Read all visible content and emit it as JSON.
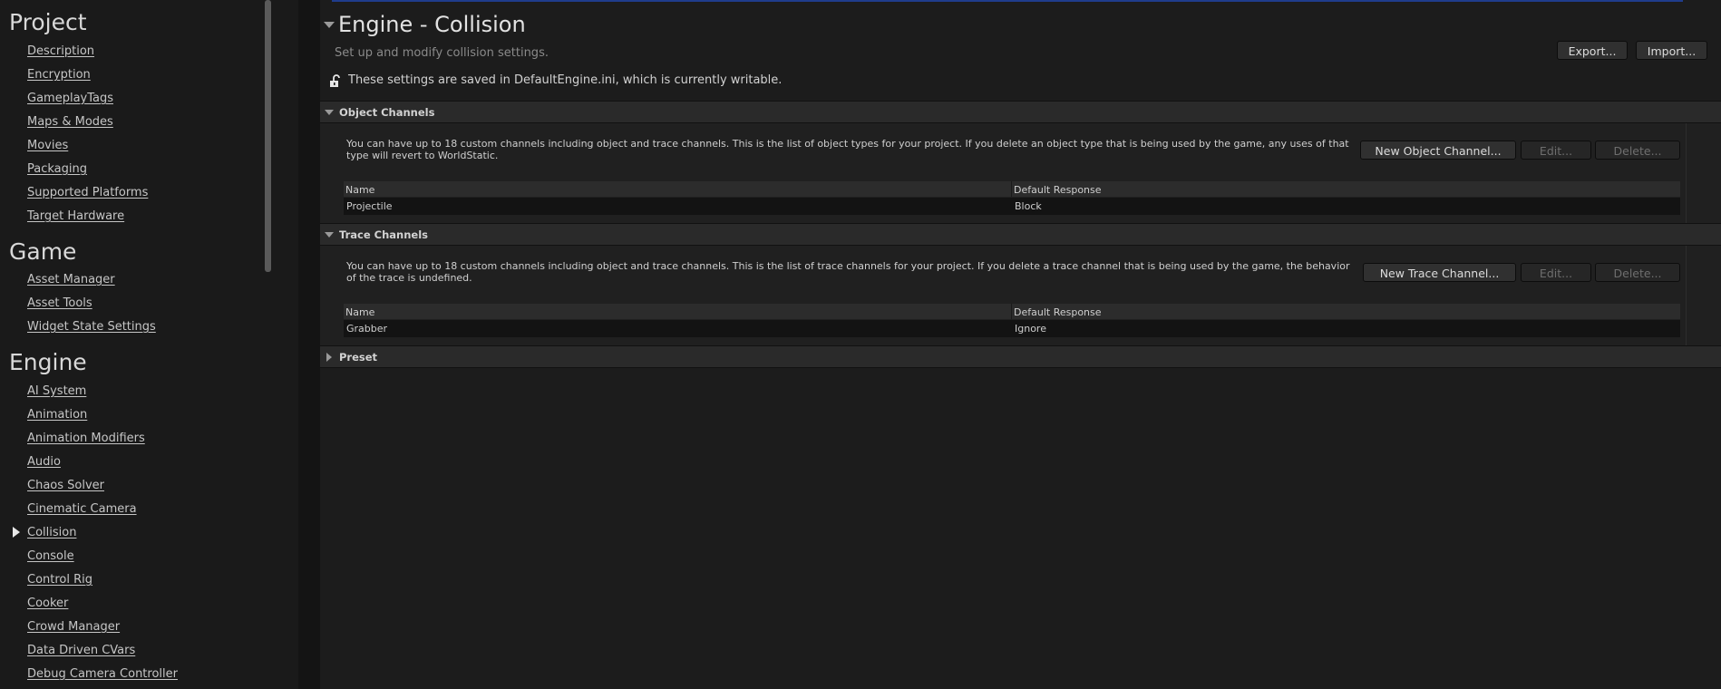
{
  "sidebar": {
    "categories": [
      {
        "title": "Project",
        "items": [
          "Description",
          "Encryption",
          "GameplayTags",
          "Maps & Modes",
          "Movies",
          "Packaging",
          "Supported Platforms",
          "Target Hardware"
        ]
      },
      {
        "title": "Game",
        "items": [
          "Asset Manager",
          "Asset Tools",
          "Widget State Settings"
        ]
      },
      {
        "title": "Engine",
        "items": [
          "AI System",
          "Animation",
          "Animation Modifiers",
          "Audio",
          "Chaos Solver",
          "Cinematic Camera",
          "Collision",
          "Console",
          "Control Rig",
          "Cooker",
          "Crowd Manager",
          "Data Driven CVars",
          "Debug Camera Controller"
        ]
      }
    ],
    "selected_item": "Collision"
  },
  "header": {
    "title": "Engine - Collision",
    "subtitle": "Set up and modify collision settings.",
    "export_label": "Export...",
    "import_label": "Import...",
    "saved_notice": "These settings are saved in DefaultEngine.ini, which is currently writable."
  },
  "object_channels": {
    "label": "Object Channels",
    "description": "You can have up to 18 custom channels including object and trace channels. This is the list of object types for your project. If you delete an object type that is being used by the game, any uses of that type will revert to WorldStatic.",
    "new_label": "New Object Channel...",
    "edit_label": "Edit...",
    "delete_label": "Delete...",
    "columns": [
      "Name",
      "Default Response"
    ],
    "rows": [
      [
        "Projectile",
        "Block"
      ]
    ]
  },
  "trace_channels": {
    "label": "Trace Channels",
    "description": "You can have up to 18 custom channels including object and trace channels. This is the list of trace channels for your project. If you delete a trace channel that is being used by the game, the behavior of the trace is undefined.",
    "new_label": "New Trace Channel...",
    "edit_label": "Edit...",
    "delete_label": "Delete...",
    "columns": [
      "Name",
      "Default Response"
    ],
    "rows": [
      [
        "Grabber",
        "Ignore"
      ]
    ]
  },
  "preset": {
    "label": "Preset"
  },
  "colors": {
    "accent": "#1f3c8c",
    "background": "#1c1c1c",
    "sidebar": "#1a1a1a"
  }
}
